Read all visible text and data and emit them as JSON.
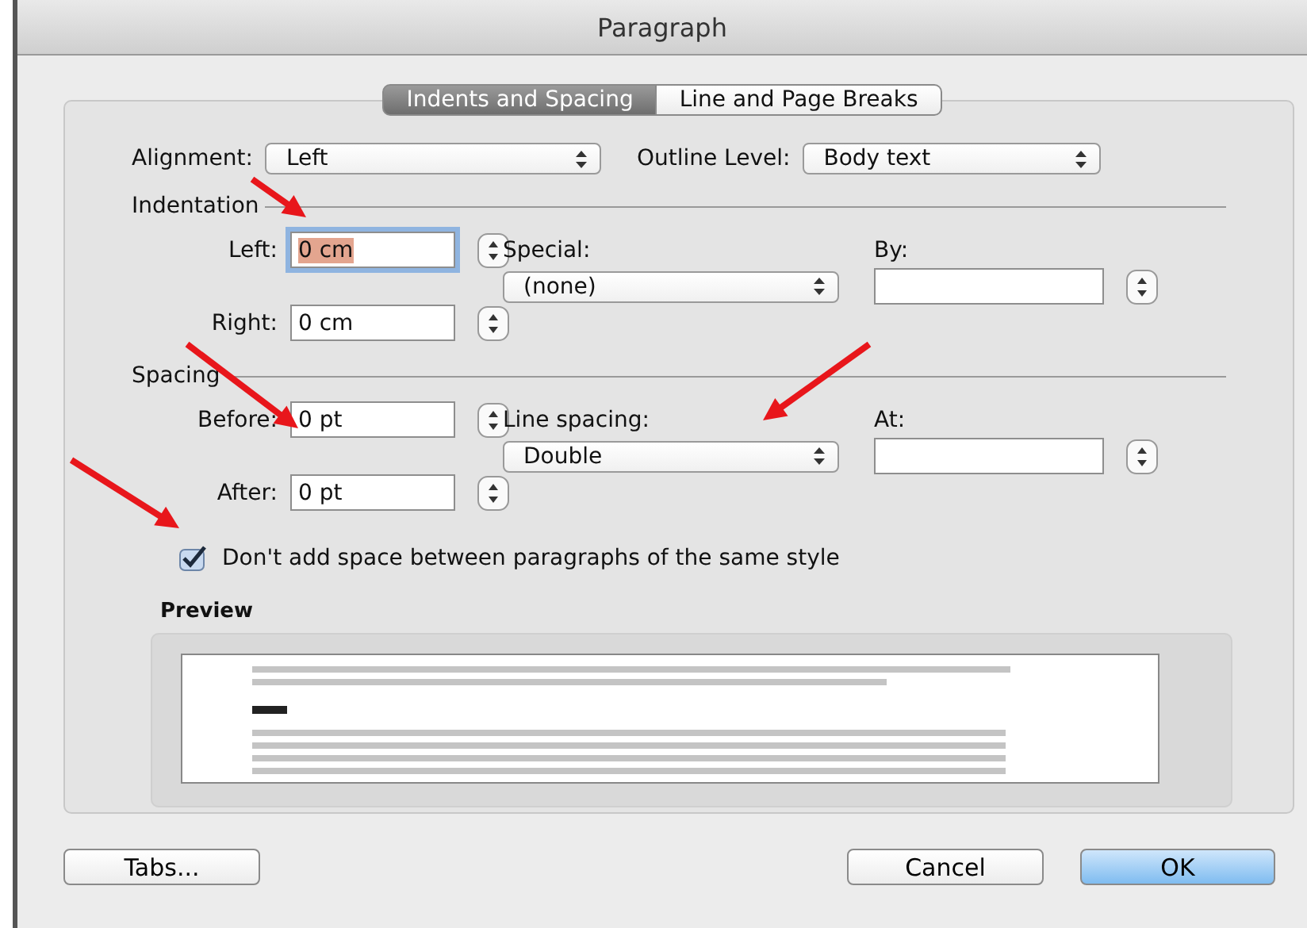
{
  "window": {
    "title": "Paragraph"
  },
  "tabs": [
    {
      "label": "Indents and Spacing",
      "selected": true
    },
    {
      "label": "Line and Page Breaks",
      "selected": false
    }
  ],
  "general": {
    "alignment": {
      "label": "Alignment:",
      "value": "Left"
    },
    "outline_level": {
      "label": "Outline Level:",
      "value": "Body text"
    }
  },
  "indentation": {
    "title": "Indentation",
    "left": {
      "label": "Left:",
      "value": "0 cm",
      "focused": true
    },
    "right": {
      "label": "Right:",
      "value": "0 cm",
      "focused": false
    },
    "special": {
      "label": "Special:",
      "value": "(none)"
    },
    "by": {
      "label": "By:"
    }
  },
  "spacing": {
    "title": "Spacing",
    "before": {
      "label": "Before:",
      "value": "0 pt",
      "focused": false
    },
    "after": {
      "label": "After:",
      "value": "0 pt",
      "focused": false
    },
    "line_spacing": {
      "label": "Line spacing:",
      "value": "Double"
    },
    "at": {
      "label": "At:"
    }
  },
  "no_space_checkbox": {
    "label": "Don't add space between paragraphs of the same style",
    "checked": true
  },
  "preview": {
    "title": "Preview"
  },
  "buttons": [
    {
      "label": "Tabs...",
      "kind": "plain"
    },
    {
      "label": "Cancel",
      "kind": "plain"
    },
    {
      "label": "OK",
      "kind": "default"
    }
  ]
}
